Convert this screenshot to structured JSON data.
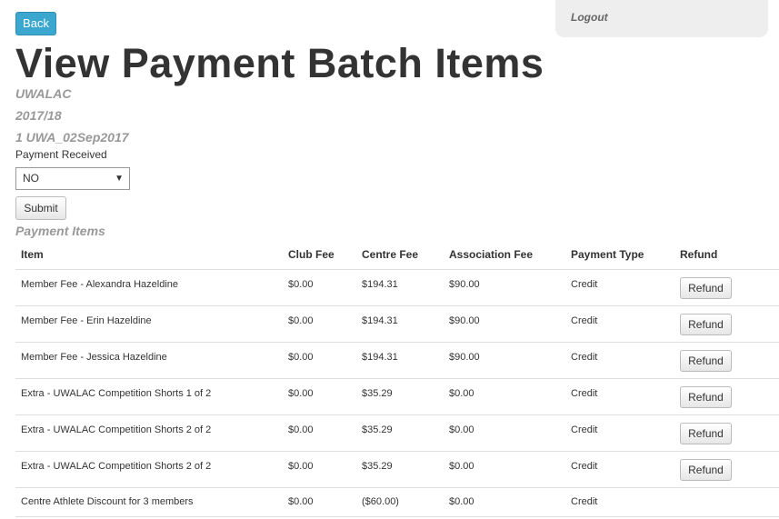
{
  "header": {
    "back_label": "Back",
    "logout_label": "Logout",
    "page_title": "View Payment Batch Items"
  },
  "batch": {
    "organisation": "UWALAC",
    "season": "2017/18",
    "batch_name": "1 UWA_02Sep2017"
  },
  "form": {
    "payment_received_label": "Payment Received",
    "payment_received_value": "NO",
    "submit_label": "Submit"
  },
  "items_section": {
    "heading": "Payment Items",
    "columns": [
      "Item",
      "Club Fee",
      "Centre Fee",
      "Association Fee",
      "Payment Type",
      "Refund"
    ],
    "rows": [
      {
        "item": "Member Fee - Alexandra Hazeldine",
        "club_fee": "$0.00",
        "centre_fee": "$194.31",
        "association_fee": "$90.00",
        "payment_type": "Credit",
        "refund": "Refund"
      },
      {
        "item": "Member Fee - Erin Hazeldine",
        "club_fee": "$0.00",
        "centre_fee": "$194.31",
        "association_fee": "$90.00",
        "payment_type": "Credit",
        "refund": "Refund"
      },
      {
        "item": "Member Fee - Jessica Hazeldine",
        "club_fee": "$0.00",
        "centre_fee": "$194.31",
        "association_fee": "$90.00",
        "payment_type": "Credit",
        "refund": "Refund"
      },
      {
        "item": "Extra - UWALAC Competition Shorts 1 of 2",
        "club_fee": "$0.00",
        "centre_fee": "$35.29",
        "association_fee": "$0.00",
        "payment_type": "Credit",
        "refund": "Refund"
      },
      {
        "item": "Extra - UWALAC Competition Shorts 2 of 2",
        "club_fee": "$0.00",
        "centre_fee": "$35.29",
        "association_fee": "$0.00",
        "payment_type": "Credit",
        "refund": "Refund"
      },
      {
        "item": "Extra - UWALAC Competition Shorts 2 of 2",
        "club_fee": "$0.00",
        "centre_fee": "$35.29",
        "association_fee": "$0.00",
        "payment_type": "Credit",
        "refund": "Refund"
      },
      {
        "item": "Centre Athlete Discount for 3 members",
        "club_fee": "$0.00",
        "centre_fee": "($60.00)",
        "association_fee": "$0.00",
        "payment_type": "Credit",
        "refund": ""
      }
    ]
  },
  "colors": {
    "primary_button": "#3ba7cf",
    "muted_text": "#999999",
    "panel_background": "#eeeeee"
  }
}
